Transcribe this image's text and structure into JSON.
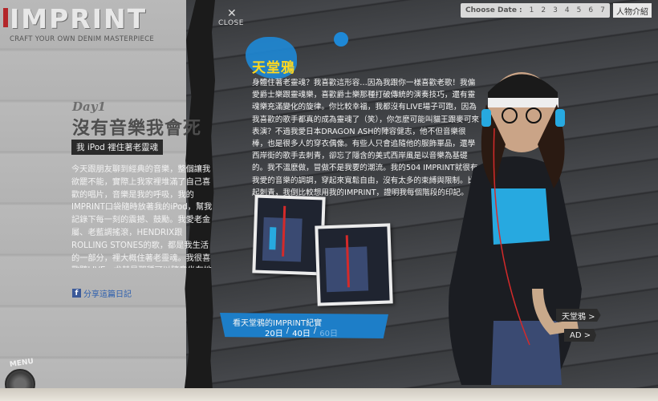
{
  "brand": {
    "logo": "IMPRINT",
    "tagline": "CRAFT YOUR OWN DENIM MASTERPIECE"
  },
  "close": {
    "label": "CLOSE"
  },
  "date_nav": {
    "label": "Choose Date :",
    "days": [
      "1",
      "2",
      "3",
      "4",
      "5",
      "6",
      "7"
    ]
  },
  "people_link": "人物介紹",
  "diary": {
    "day": "Day1",
    "title": "沒有音樂我會死",
    "subtitle": "我 iPod 裡住著老靈魂",
    "body": "今天跟朋友聊到經典的音樂，整個讓我欲罷不能，實際上我家裡堆滿了自己喜歡的唱片，音樂是我的呼吸，我的IMPRINT口袋隨時放著我的iPod，幫我記錄下每一刻的震撼、鼓勵。我愛老金屬、老藍調搖滾，HENDRIX跟ROLLING STONES的歌，都是我生活的一部分，裡大概住著老靈魂。我很喜歡聽LIVE，尤其是那種可以隨意坐在地上、躺在地上，去感受自己的靈魂跟著一股自由奔放的現場能量。IMPRINT總是我的最佳夥伴，陪我記錄的感動與解放。",
    "share": "分享這篇日記"
  },
  "menu": {
    "label": "MENU"
  },
  "star": {
    "name": "天堂鴉",
    "story": "身體住著老靈魂？我喜歡這形容…因為我跟你一樣喜歡老歌！我偏愛爵士樂跟靈魂樂，喜歡爵士樂那種打破傳統的演奏技巧，還有靈魂樂充滿變化的旋律。你比較幸福，我都沒有LIVE場子可跑，因為我喜歡的歌手都真的成為靈魂了（笑），你怎麼可能叫貓王跟麥可來表演？不過我愛日本DRAGON ASH的陣容健志，他不但音樂很棒，也是很多人的穿衣偶像。有些人只會追隨他的服飾單品，還學西岸街的歌手去刺青，卻忘了隱含的美式西岸風是以音樂為基礎的。我不溫麼做，冒做不是我要的潮流。我的504 IMPRINT就很有我愛的音樂的調調，穿起來寬鬆自由，沒有太多的束縛與限制。比起刺青，我倒比較想用我的IMPRINT，證明我每個階段的印記。"
  },
  "diary_counter": {
    "title": "看天堂鴉的IMPRINT紀實",
    "counts": [
      "20日",
      "40日",
      "60日"
    ],
    "separator": "/"
  },
  "nav": {
    "next_star": "天堂鴉 >",
    "ad": "AD >"
  },
  "icons": [
    "close-icon",
    "facebook-icon",
    "menu-dial-icon",
    "arrow-right-icon"
  ],
  "colors": {
    "accent_yellow": "#ffd81e",
    "accent_blue": "#1e88d6",
    "fb_blue": "#3b5998",
    "brand_red": "#b3262a"
  }
}
